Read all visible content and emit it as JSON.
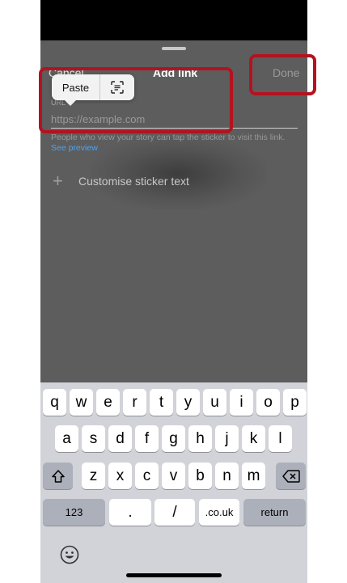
{
  "header": {
    "cancel_label": "Cancel",
    "title": "Add link",
    "done_label": "Done"
  },
  "popup": {
    "paste_label": "Paste",
    "scan_icon": "scan-text-icon"
  },
  "url_field": {
    "label": "URL",
    "placeholder": "https://example.com",
    "value": ""
  },
  "helper": {
    "text": "People who view your story can tap the sticker to visit this link.",
    "preview_link": "See preview"
  },
  "customise": {
    "label": "Customise sticker text"
  },
  "keyboard": {
    "row1": [
      "q",
      "w",
      "e",
      "r",
      "t",
      "y",
      "u",
      "i",
      "o",
      "p"
    ],
    "row2": [
      "a",
      "s",
      "d",
      "f",
      "g",
      "h",
      "j",
      "k",
      "l"
    ],
    "row3": [
      "z",
      "x",
      "c",
      "v",
      "b",
      "n",
      "m"
    ],
    "numbers_label": "123",
    "dot_label": ".",
    "slash_label": "/",
    "domain_label": ".co.uk",
    "return_label": "return"
  },
  "colors": {
    "highlight_red": "#b4121f",
    "link_blue": "#4ba3f5"
  }
}
